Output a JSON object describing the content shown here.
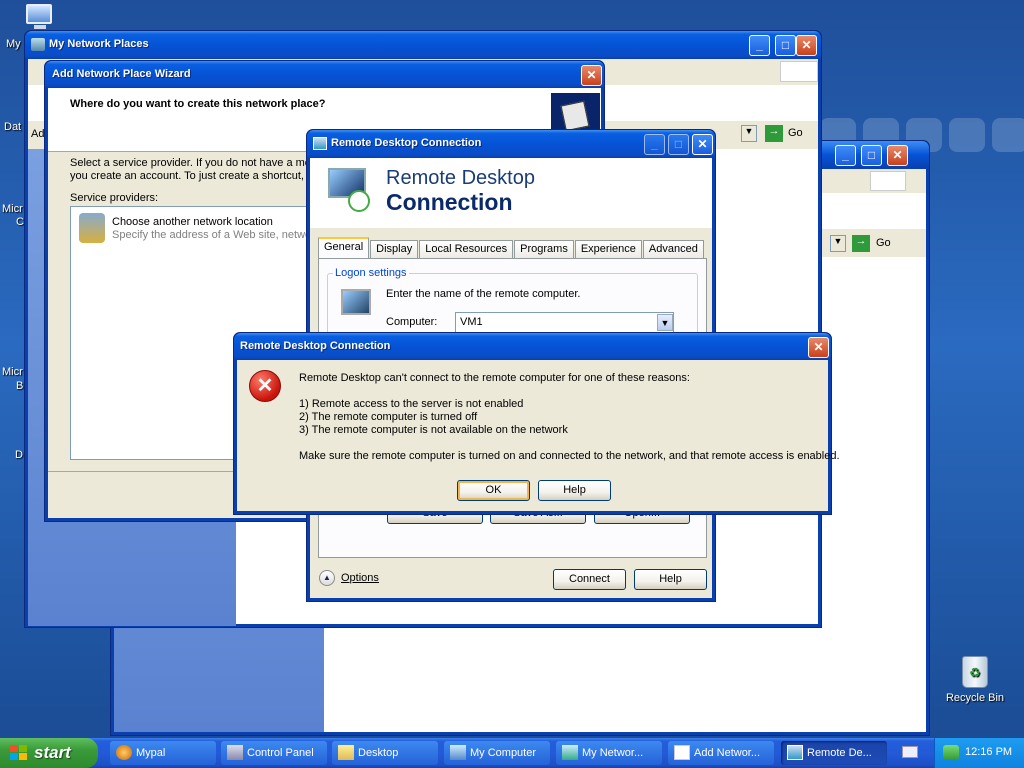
{
  "desktop": {
    "icon_labels_left": [
      "My",
      "Dat",
      "Micr",
      "C",
      "Micr",
      "B",
      "D"
    ],
    "recycle_bin": "Recycle Bin"
  },
  "network_places": {
    "title": "My Network Places",
    "go_label": "Go",
    "address_prefix": "Ad"
  },
  "back_window": {
    "go_label": "Go"
  },
  "wizard": {
    "title": "Add Network Place Wizard",
    "heading": "Where do you want to create this network place?",
    "intro_line1": "Select a service provider.  If you do not have a me",
    "intro_line2": "you create an account.  To just create a shortcut,",
    "providers_label": "Service providers:",
    "provider_name": "Choose another network location",
    "provider_desc": "Specify the address of a Web site, netwo"
  },
  "rdc": {
    "title": "Remote Desktop Connection",
    "banner_line1": "Remote Desktop",
    "banner_line2": "Connection",
    "tabs": [
      "General",
      "Display",
      "Local Resources",
      "Programs",
      "Experience",
      "Advanced"
    ],
    "group_label": "Logon settings",
    "instruction": "Enter the name of the remote computer.",
    "computer_label": "Computer:",
    "computer_value": "VM1",
    "save_label": "Save",
    "save_as_label": "Save As...",
    "open_label": "Open...",
    "options_label": "Options",
    "connect_label": "Connect",
    "help_label": "Help"
  },
  "error_dialog": {
    "title": "Remote Desktop Connection",
    "line_intro": "Remote Desktop can't connect to the remote computer for one of these reasons:",
    "reasons": [
      "1) Remote access to the server is not enabled",
      "2) The remote computer is turned off",
      "3) The remote computer is not available on the network"
    ],
    "line_advice": "Make sure the remote computer is turned on and connected to the network, and that remote access is enabled.",
    "ok_label": "OK",
    "help_label": "Help"
  },
  "taskbar": {
    "start_label": "start",
    "tasks": [
      "Mypal",
      "Control Panel",
      "Desktop",
      "My Computer",
      "My Networ...",
      "Add Networ...",
      "Remote De..."
    ],
    "clock": "12:16 PM"
  }
}
